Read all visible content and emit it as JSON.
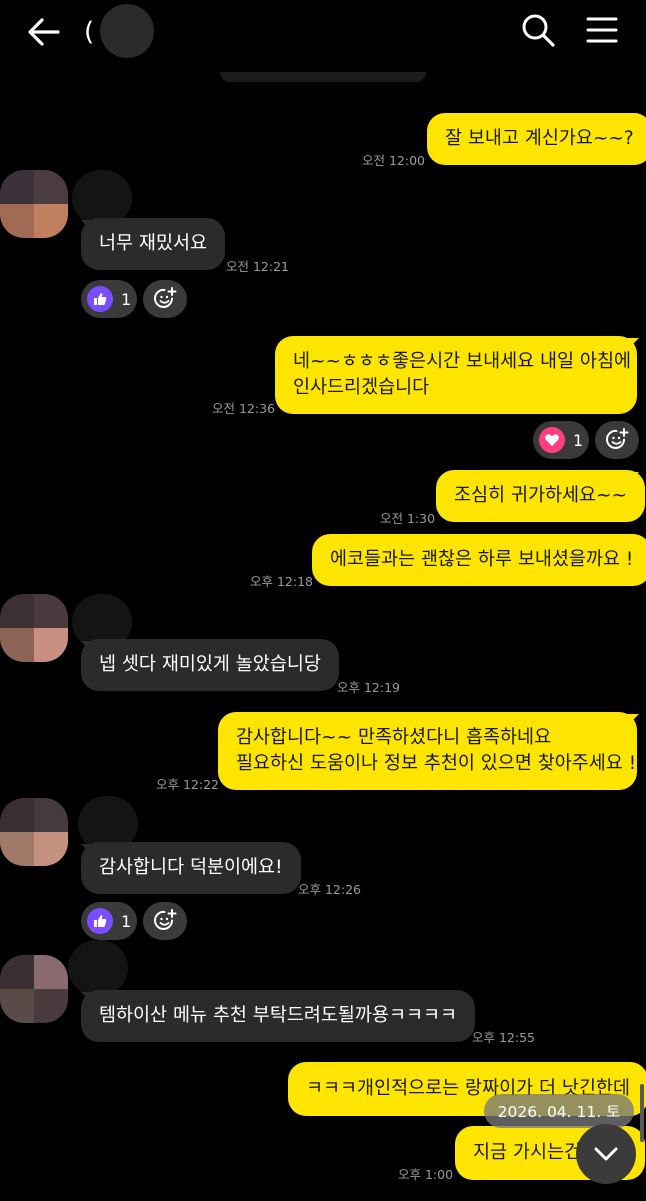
{
  "header": {
    "title": "(",
    "back_icon": "arrow-left-icon",
    "search_icon": "search-icon",
    "menu_icon": "hamburger-menu-icon"
  },
  "colors": {
    "my_bubble": "#fee500",
    "their_bubble": "#2b2b2b",
    "background": "#000000",
    "like_badge": "#7c4dff",
    "heart_badge": "#ff3d7f"
  },
  "messages": [
    {
      "from": "me",
      "lines": [
        "잘 보내고 계신가요~~?"
      ],
      "time": "오전 12:00"
    },
    {
      "from": "them",
      "lines": [
        "너무 재밌서요"
      ],
      "time": "오전 12:21",
      "reaction": {
        "icon": "thumbs-up-icon",
        "count": "1"
      }
    },
    {
      "from": "me",
      "lines": [
        "네~~ㅎㅎㅎ좋은시간 보내세요 내일 아침에",
        "인사드리겠습니다"
      ],
      "time": "오전 12:36",
      "reaction": {
        "icon": "heart-icon",
        "count": "1"
      }
    },
    {
      "from": "me",
      "lines": [
        "조심히 귀가하세요~~"
      ],
      "time": "오전 1:30"
    },
    {
      "from": "me",
      "lines": [
        "에코들과는 괜찮은 하루 보내셨을까요 !"
      ],
      "time": "오후 12:18"
    },
    {
      "from": "them",
      "lines": [
        "넵 셋다 재미있게 놀았습니당"
      ],
      "time": "오후 12:19"
    },
    {
      "from": "me",
      "lines": [
        "감사합니다~~ 만족하셨다니 흡족하네요",
        "필요하신 도움이나 정보 추천이 있으면 찾아주세요 !"
      ],
      "time": "오후 12:22"
    },
    {
      "from": "them",
      "lines": [
        "감사합니다 덕분이에요!"
      ],
      "time": "오후 12:26",
      "reaction": {
        "icon": "thumbs-up-icon",
        "count": "1"
      }
    },
    {
      "from": "them",
      "lines": [
        "템하이산 메뉴 추천 부탁드려도될까용ㅋㅋㅋㅋ"
      ],
      "time": "오후 12:55"
    },
    {
      "from": "me",
      "lines": [
        "ㅋㅋㅋ개인적으로는 랑짜이가 더 낫긴한데"
      ],
      "time": ""
    },
    {
      "from": "me",
      "lines": [
        "지금 가시는건"
      ],
      "time": "오후 1:00"
    }
  ],
  "date_chip": "2026. 04. 11. 토",
  "scroll_down_icon": "chevron-down-icon",
  "add_reaction_icon": "add-emoji-icon"
}
